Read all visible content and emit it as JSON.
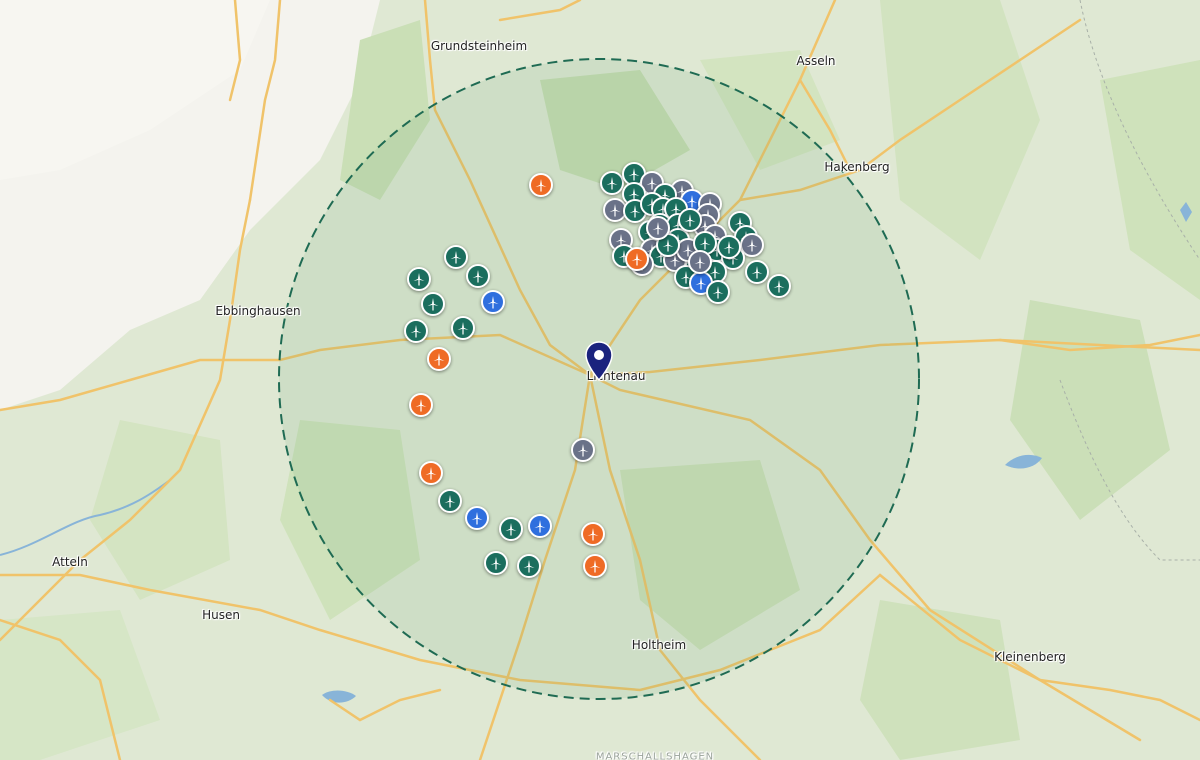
{
  "colors": {
    "background": "#dfe8d3",
    "forest": "#cadfb6",
    "open_land": "#f4f3ee",
    "road": "#f0c36a",
    "river": "#88b4d8",
    "radius_fill": "#5a9a6a",
    "radius_stroke": "#1f6b53",
    "pin": "#1a237e",
    "status": {
      "operating": "#1b6e5e",
      "planned": "#6a7288",
      "approved": "#2f6fde",
      "proposed": "#ef6b25"
    }
  },
  "places": [
    {
      "id": "grundsteinheim",
      "name": "Grundsteinheim"
    },
    {
      "id": "asseln",
      "name": "Asseln"
    },
    {
      "id": "hakenberg",
      "name": "Hakenberg"
    },
    {
      "id": "ebbinghausen",
      "name": "Ebbinghausen"
    },
    {
      "id": "lichtenau",
      "name": "Lichtenau"
    },
    {
      "id": "atteln",
      "name": "Atteln"
    },
    {
      "id": "husen",
      "name": "Husen"
    },
    {
      "id": "holtheim",
      "name": "Holtheim"
    },
    {
      "id": "kleinenberg",
      "name": "Kleinenberg"
    },
    {
      "id": "marschallshagen",
      "name": "MARSCHALLSHAGEN"
    }
  ],
  "search_radius": {
    "center_place": "Lichtenau"
  },
  "turbine_markers": {
    "icon": "wind-turbine-icon",
    "counts": {
      "operating": 50,
      "planned": 22,
      "approved": 6,
      "proposed": 9
    }
  },
  "location_pin": {
    "icon": "location-pin-icon",
    "place": "Lichtenau"
  }
}
